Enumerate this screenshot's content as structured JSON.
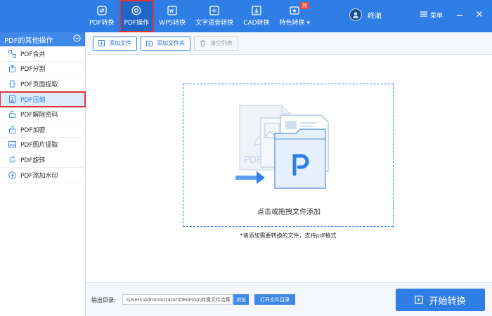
{
  "colors": {
    "brand_blue": "#2f7ee6",
    "active_blue": "#1f66c9",
    "highlight_red": "#e0353a",
    "hot_badge": "#f04b3a"
  },
  "nav": {
    "items": [
      {
        "label": "PDF转换",
        "icon": "pdf-convert-icon"
      },
      {
        "label": "PDF操作",
        "icon": "pdf-operate-icon",
        "active": true
      },
      {
        "label": "WPS转换",
        "icon": "wps-icon"
      },
      {
        "label": "文字语音转换",
        "icon": "audio-wave-icon"
      },
      {
        "label": "CAD转换",
        "icon": "cad-icon"
      },
      {
        "label": "特色转换",
        "icon": "feature-icon",
        "badge": "热"
      }
    ]
  },
  "user": {
    "name": "终澈",
    "menu_label": "菜单"
  },
  "sidebar": {
    "header": "PDF的其他操作",
    "items": [
      {
        "label": "PDF合并",
        "icon": "merge-icon"
      },
      {
        "label": "PDF分割",
        "icon": "split-icon"
      },
      {
        "label": "PDF页面提取",
        "icon": "page-extract-icon"
      },
      {
        "label": "PDF压缩",
        "icon": "compress-icon",
        "active": true
      },
      {
        "label": "PDF解除密码",
        "icon": "unlock-icon"
      },
      {
        "label": "PDF加密",
        "icon": "lock-icon"
      },
      {
        "label": "PDF图片提取",
        "icon": "image-extract-icon"
      },
      {
        "label": "PDF旋转",
        "icon": "rotate-icon"
      },
      {
        "label": "PDF添加水印",
        "icon": "watermark-icon"
      }
    ]
  },
  "toolbar": {
    "add_file": "添加文件",
    "add_folder": "添加文件夹",
    "clear_list": "清空列表"
  },
  "dropzone": {
    "text": "点击或拖拽文件添加",
    "hint": "*请添加需要转换的文件，支持pdf格式"
  },
  "bottom": {
    "output_label": "输出目录:",
    "output_path": ":\\Users\\Administrator\\Desktop\\转换文件合集",
    "browse": "浏览",
    "open_dir": "打开文件目录",
    "start": "开始转换"
  }
}
